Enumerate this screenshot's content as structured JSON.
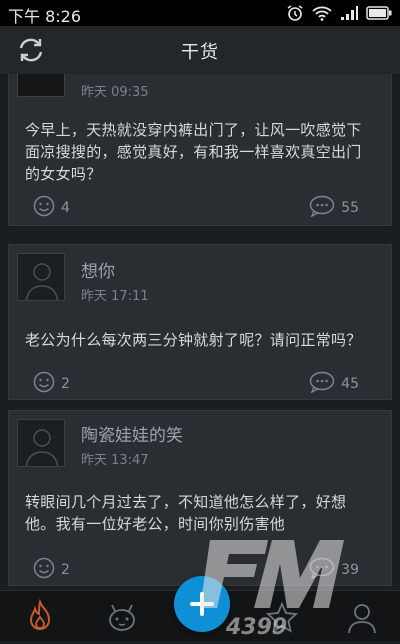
{
  "status_bar": {
    "time": "下午 8:26",
    "icons": [
      "alarm-icon",
      "wifi-icon",
      "signal-icon",
      "battery-icon"
    ]
  },
  "header": {
    "title": "干货",
    "refresh_icon": "refresh-icon"
  },
  "posts": [
    {
      "username": "",
      "time": "昨天 09:35",
      "content": "今早上，天热就没穿内裤出门了，让风一吹感觉下面凉搜搜的，感觉真好，有和我一样喜欢真空出门的女女吗？",
      "likes": "4",
      "comments": "55"
    },
    {
      "username": "想你",
      "time": "昨天 17:11",
      "content": "老公为什么每次两三分钟就射了呢？请问正常吗？",
      "likes": "2",
      "comments": "45"
    },
    {
      "username": "陶瓷娃娃的笑",
      "time": "昨天 13:47",
      "content": "转眼间几个月过去了，不知道他怎么样了，好想他。我有一位好老公，时间你别伤害他",
      "likes": "2",
      "comments": "39"
    }
  ],
  "tab_bar": {
    "tabs": [
      "hot-flame-icon",
      "cute-character-icon",
      "compose-plus-icon",
      "star-icon",
      "profile-icon"
    ]
  },
  "watermark": {
    "brand": "FM",
    "sub": "4399"
  },
  "colors": {
    "background": "#1b1e21",
    "card": "#2a2d31",
    "accent": "#0f8fd6"
  }
}
